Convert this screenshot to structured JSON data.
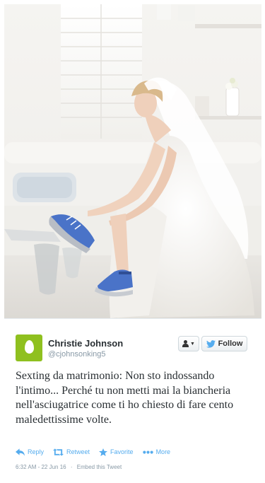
{
  "tweet": {
    "author": {
      "name": "Christie Johnson",
      "handle": "@cjohnsonking5",
      "avatar": "egg-avatar-icon",
      "avatar_color": "#8fc01f"
    },
    "buttons": {
      "follow": "Follow",
      "user_menu": "person-dropdown-icon"
    },
    "text": "Sexting da matrimonio: Non sto indossando l'intimo... Perché tu non metti mai la biancheria nell'asciugatrice come ti ho chiesto di fare cento maledettissime volte.",
    "actions": [
      {
        "label": "Reply",
        "icon": "reply-icon"
      },
      {
        "label": "Retweet",
        "icon": "retweet-icon"
      },
      {
        "label": "Favorite",
        "icon": "star-icon"
      },
      {
        "label": "More",
        "icon": "more-dots-icon"
      }
    ],
    "timestamp": "6:32 AM - 22 Jun 16",
    "embed": "Embed this Tweet",
    "accent_color": "#55acee"
  },
  "photo": {
    "subject": "bride-tying-sneakers-photo"
  }
}
